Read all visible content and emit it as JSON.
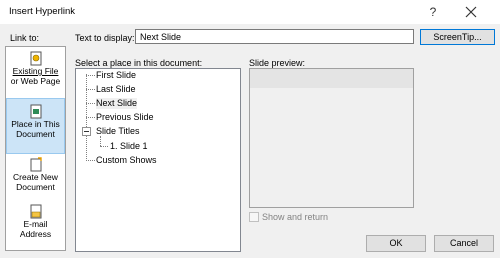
{
  "window": {
    "title": "Insert Hyperlink",
    "help_glyph": "?",
    "close_glyph": "✕"
  },
  "link_to": {
    "label": "Link to:",
    "items": [
      {
        "line1": "Existing File",
        "line2": "or Web Page",
        "icon": "web-page-icon"
      },
      {
        "line1": "Place in This",
        "line2": "Document",
        "icon": "document-place-icon",
        "selected": true
      },
      {
        "line1": "Create New",
        "line2": "Document",
        "icon": "new-document-icon"
      },
      {
        "line1": "E-mail",
        "line2": "Address",
        "icon": "email-icon"
      }
    ]
  },
  "text_to_display": {
    "label": "Text to display:",
    "value": "Next Slide"
  },
  "screentip_button": "ScreenTip...",
  "select_place": {
    "label": "Select a place in this document:",
    "items": [
      {
        "text": "First Slide"
      },
      {
        "text": "Last Slide"
      },
      {
        "text": "Next Slide",
        "selected": true
      },
      {
        "text": "Previous Slide"
      },
      {
        "text": "Slide Titles",
        "expander": "minus"
      },
      {
        "text": "1. Slide 1",
        "child": true
      },
      {
        "text": "Custom Shows"
      }
    ]
  },
  "slide_preview": {
    "label": "Slide preview:"
  },
  "show_and_return": {
    "label": "Show and return",
    "checked": false
  },
  "ok_button": "OK",
  "cancel_button": "Cancel"
}
